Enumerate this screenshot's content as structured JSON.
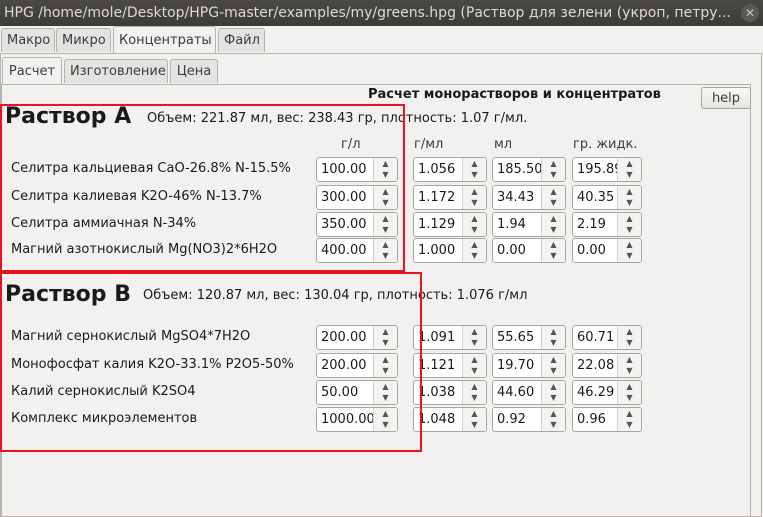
{
  "window": {
    "title": "HPG /home/mole/Desktop/HPG-master/examples/my/greens.hpg (Раствор для зелени (укроп, петру...",
    "close_glyph": "✕"
  },
  "main_tabs": [
    "Макро",
    "Микро",
    "Концентраты",
    "Файл"
  ],
  "main_tab_active": "Концентраты",
  "sub_tabs": [
    "Расчет",
    "Изготовление",
    "Цена"
  ],
  "sub_tab_active": "Расчет",
  "heading": "Расчет монорастворов и концентратов",
  "help_label": "help",
  "columns": [
    "г/л",
    "г/мл",
    "мл",
    "гр. жидк."
  ],
  "solution_a": {
    "title": "Раствор А",
    "info": "Объем: 221.87 мл, вес: 238.43 гр, плотность: 1.07 г/мл.",
    "rows": [
      {
        "label": "Селитра кальциевая CaO-26.8% N-15.5%",
        "gl": "100.00",
        "gml": "1.056",
        "ml": "185.50",
        "gr": "195.89"
      },
      {
        "label": "Селитра калиевая K2O-46% N-13.7%",
        "gl": "300.00",
        "gml": "1.172",
        "ml": "34.43",
        "gr": "40.35"
      },
      {
        "label": "Селитра аммиачная N-34%",
        "gl": "350.00",
        "gml": "1.129",
        "ml": "1.94",
        "gr": "2.19"
      },
      {
        "label": "Магний азотнокислый Mg(NO3)2*6H2O",
        "gl": "400.00",
        "gml": "1.000",
        "ml": "0.00",
        "gr": "0.00"
      }
    ]
  },
  "solution_b": {
    "title": "Раствор В",
    "info": "Объем: 120.87 мл, вес: 130.04 гр, плотность: 1.076 г/мл",
    "rows": [
      {
        "label": "Магний сернокислый MgSO4*7H2O",
        "gl": "200.00",
        "gml": "1.091",
        "ml": "55.65",
        "gr": "60.71"
      },
      {
        "label": "Монофосфат калия K2O-33.1% P2O5-50%",
        "gl": "200.00",
        "gml": "1.121",
        "ml": "19.70",
        "gr": "22.08"
      },
      {
        "label": "Калий сернокислый K2SO4",
        "gl": "50.00",
        "gml": "1.038",
        "ml": "44.60",
        "gr": "46.29"
      },
      {
        "label": "Комплекс микроэлементов",
        "gl": "1000.00",
        "gml": "1.048",
        "ml": "0.92",
        "gr": "0.96"
      }
    ]
  },
  "annotation_color": "#e8141e"
}
